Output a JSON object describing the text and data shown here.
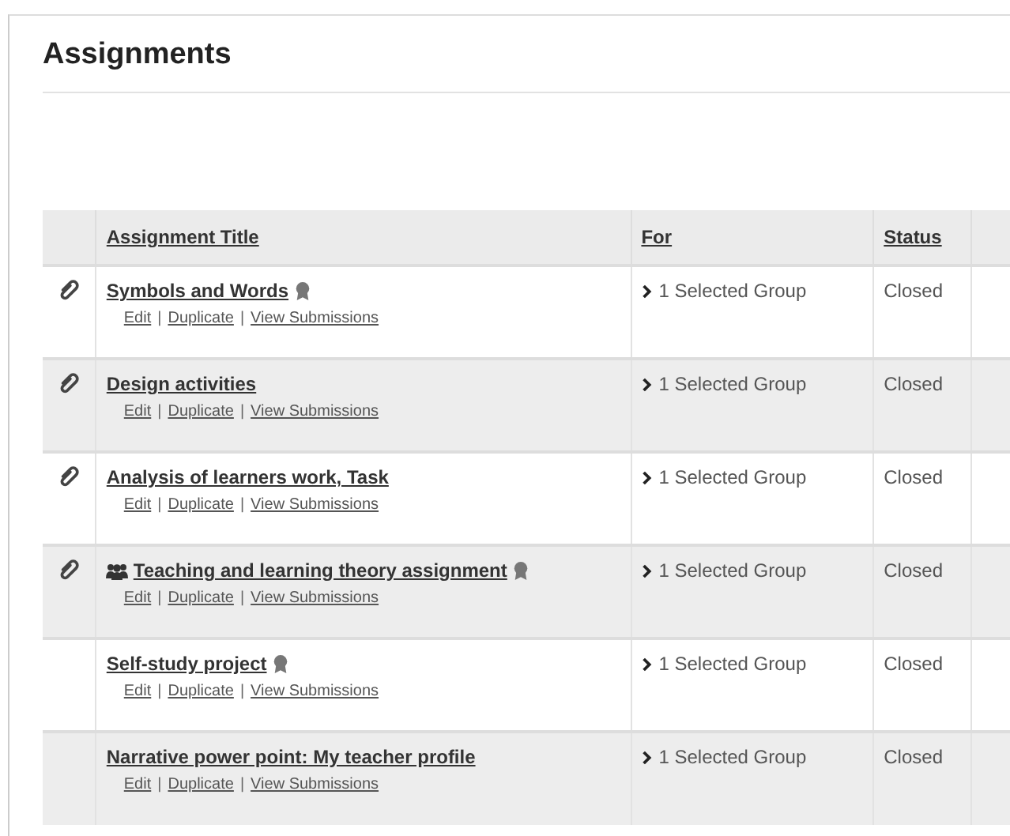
{
  "page": {
    "title": "Assignments"
  },
  "table": {
    "columns": [
      "Assignment Title",
      "For",
      "Status"
    ],
    "rows": [
      {
        "title": "Symbols and Words",
        "attachment": true,
        "group_assignment": false,
        "badge": true,
        "actions": [
          "Edit",
          "Duplicate",
          "View Submissions"
        ],
        "separators": [
          "|",
          "|"
        ],
        "for": "1 Selected Group",
        "status": "Closed"
      },
      {
        "title": "Design activities",
        "attachment": true,
        "group_assignment": false,
        "badge": false,
        "actions": [
          "Edit",
          "Duplicate",
          "View Submissions"
        ],
        "separators": [
          "|",
          "|"
        ],
        "for": "1 Selected Group",
        "status": "Closed"
      },
      {
        "title": "Analysis of learners work, Task",
        "attachment": true,
        "group_assignment": false,
        "badge": false,
        "actions": [
          "Edit",
          "Duplicate",
          "View Submissions"
        ],
        "separators": [
          "|",
          "|"
        ],
        "for": "1 Selected Group",
        "status": "Closed"
      },
      {
        "title": "Teaching and learning theory assignment",
        "attachment": true,
        "group_assignment": true,
        "badge": true,
        "actions": [
          "Edit",
          "Duplicate",
          "View Submissions"
        ],
        "separators": [
          "|",
          "|"
        ],
        "for": "1 Selected Group",
        "status": "Closed"
      },
      {
        "title": "Self-study project",
        "attachment": false,
        "group_assignment": false,
        "badge": true,
        "actions": [
          "Edit",
          "Duplicate",
          "View Submissions"
        ],
        "separators": [
          "|",
          "|"
        ],
        "for": "1 Selected Group",
        "status": "Closed"
      },
      {
        "title": "Narrative power point: My teacher profile",
        "attachment": false,
        "group_assignment": false,
        "badge": false,
        "actions": [
          "Edit",
          "Duplicate",
          "View Submissions"
        ],
        "separators": [
          "|",
          "|"
        ],
        "for": "1 Selected Group",
        "status": "Closed"
      }
    ]
  }
}
